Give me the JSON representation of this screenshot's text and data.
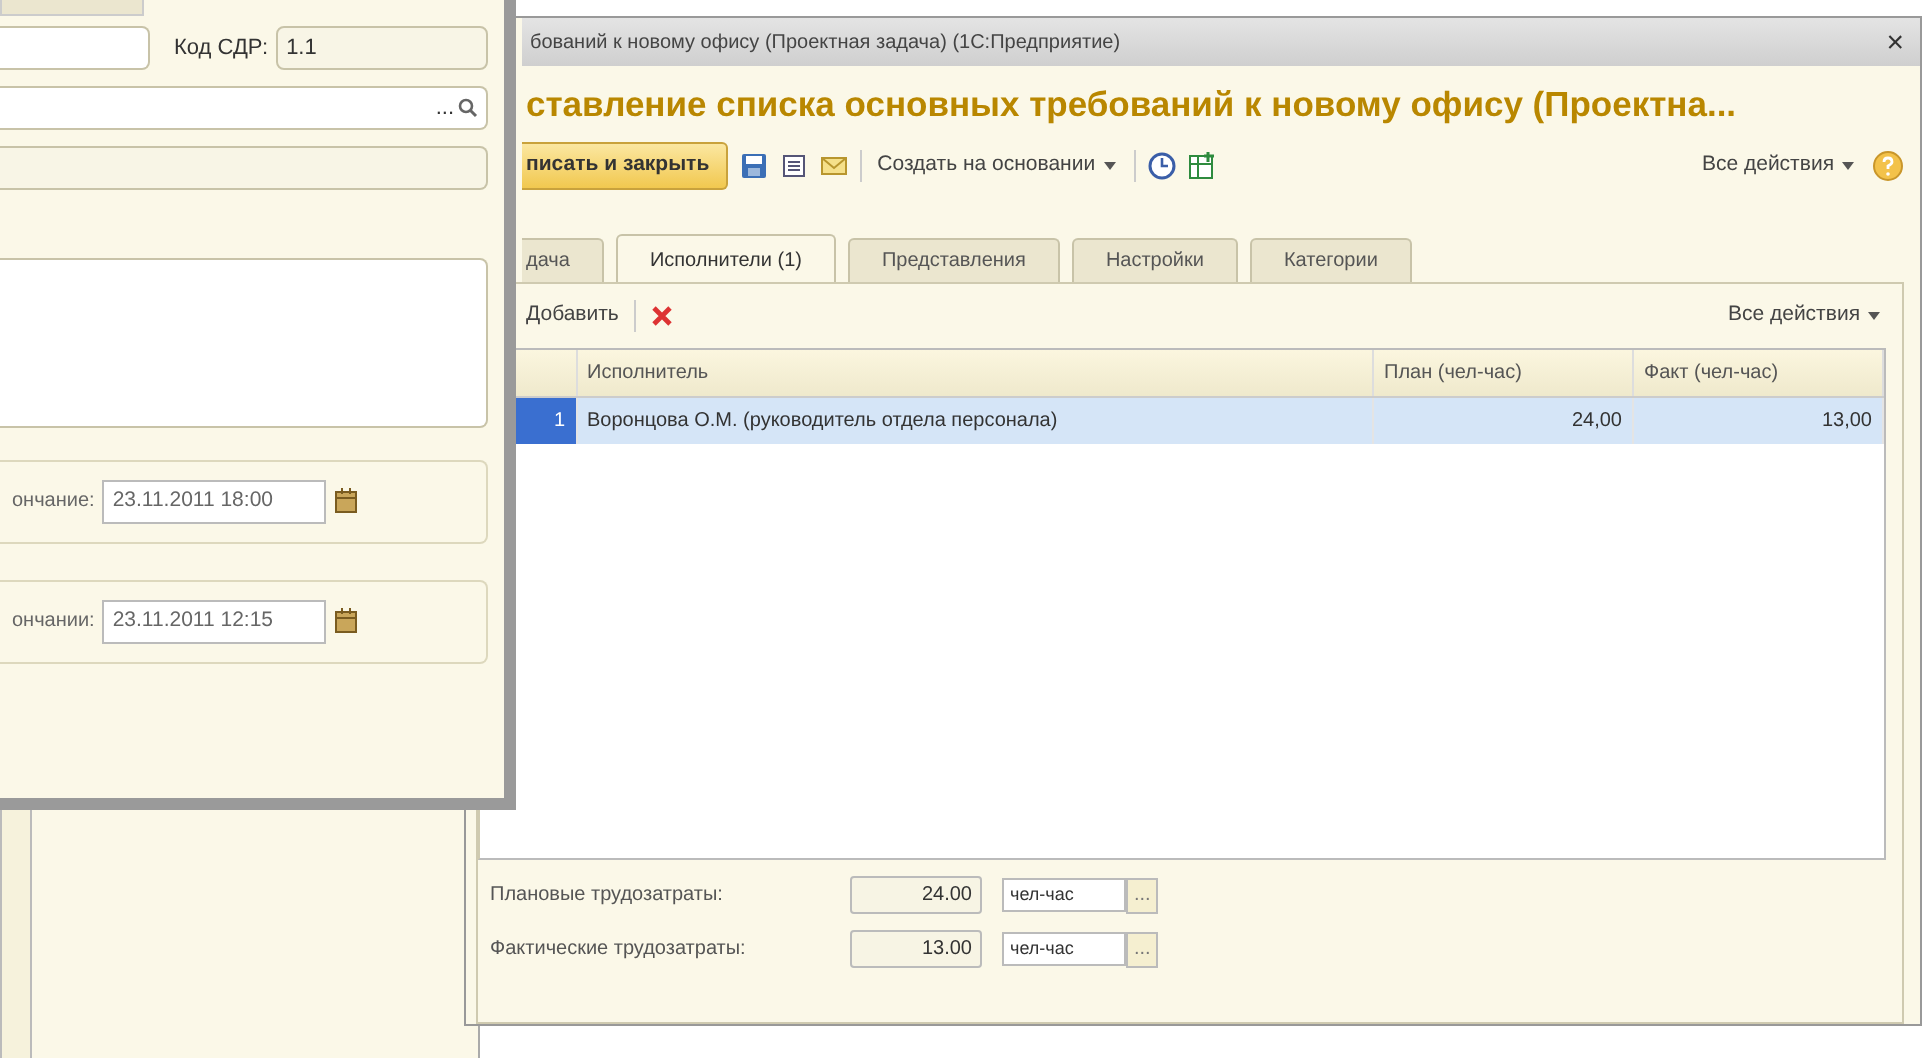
{
  "back_form": {
    "code_label": "Код СДР:",
    "code_value": "1.1",
    "lookup_button": "...",
    "dates": [
      {
        "label": "ончание:",
        "value": "23.11.2011 18:00"
      },
      {
        "label": "ончании:",
        "value": "23.11.2011 12:15"
      }
    ]
  },
  "window": {
    "title": "бований к новому офису (Проектная задача) (1С:Предприятие)",
    "close": "×"
  },
  "header": "ставление списка основных требований к новому офису (Проектна...",
  "toolbar": {
    "save_label": "писать и закрыть",
    "create_based": "Создать на основании",
    "all_actions": "Все действия"
  },
  "tabs": [
    {
      "label": "дача",
      "selected": false
    },
    {
      "label": "Исполнители (1)",
      "selected": true
    },
    {
      "label": "Представления",
      "selected": false
    },
    {
      "label": "Настройки",
      "selected": false
    },
    {
      "label": "Категории",
      "selected": false
    }
  ],
  "table_toolbar": {
    "add": "Добавить",
    "all_actions": "Все действия"
  },
  "table": {
    "columns": [
      "Исполнитель",
      "План (чел-час)",
      "Факт (чел-час)"
    ],
    "rows": [
      {
        "number": "1",
        "cells": [
          "Воронцова О.М. (руководитель отдела персонала)",
          "24,00",
          "13,00"
        ],
        "selected": true
      }
    ]
  },
  "totals": [
    {
      "label": "Плановые трудозатраты:",
      "value": "24.00",
      "unit": "чел-час",
      "button": "..."
    },
    {
      "label": "Фактические трудозатраты:",
      "value": "13.00",
      "unit": "чел-час",
      "button": "..."
    }
  ]
}
